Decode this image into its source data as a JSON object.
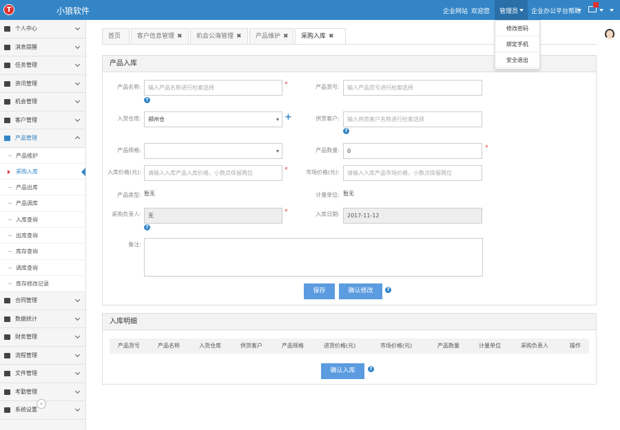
{
  "header": {
    "logo_letter": "T",
    "logo_text": "",
    "app_name": "小狼软件",
    "links": [
      "企业网站",
      "欢迎您"
    ],
    "user": "管理员",
    "help": "企业办公平台帮助"
  },
  "user_menu": [
    "修改密码",
    "绑定手机",
    "安全退出"
  ],
  "sidebar": {
    "items": [
      {
        "label": "个人中心",
        "icon": "user-icon"
      },
      {
        "label": "消息提醒",
        "icon": "bell-icon"
      },
      {
        "label": "任务管理",
        "icon": "edit-icon"
      },
      {
        "label": "资讯管理",
        "icon": "file-icon"
      },
      {
        "label": "机会管理",
        "icon": "list-icon"
      },
      {
        "label": "客户管理",
        "icon": "users-icon"
      },
      {
        "label": "产品管理",
        "icon": "dropbox-icon"
      }
    ],
    "product_sub": [
      "产品维护",
      "采购入库",
      "产品出库",
      "产品调库",
      "入库查询",
      "出库查询",
      "库存查询",
      "调库查询",
      "库存修改记录"
    ],
    "items_after": [
      {
        "label": "合同管理",
        "icon": "folder-open-icon"
      },
      {
        "label": "数据统计",
        "icon": "random-icon"
      },
      {
        "label": "财务管理",
        "icon": "yen-icon"
      },
      {
        "label": "流程管理",
        "icon": "retweet-icon"
      },
      {
        "label": "文件管理",
        "icon": "document-icon"
      },
      {
        "label": "考勤管理",
        "icon": "clock-icon"
      },
      {
        "label": "系统设置",
        "icon": "gear-icon"
      }
    ],
    "collapse": "«"
  },
  "tabs": [
    {
      "label": "首页",
      "closable": false
    },
    {
      "label": "客户信息管理",
      "closable": true
    },
    {
      "label": "机会公海管理",
      "closable": true
    },
    {
      "label": "产品维护",
      "closable": true
    },
    {
      "label": "采购入库",
      "closable": true
    }
  ],
  "form": {
    "title": "产品入库",
    "product_name": {
      "label": "产品名称:",
      "placeholder": "输入产品名称进行检索选择"
    },
    "product_code": {
      "label": "产品货号:",
      "placeholder": "输入产品货号进行检索选择"
    },
    "warehouse": {
      "label": "入货仓库:",
      "value": "郑州仓"
    },
    "supplier": {
      "label": "供货客户:",
      "placeholder": "输入供货客户名称进行检索选择"
    },
    "spec": {
      "label": "产品规格:",
      "value": ""
    },
    "quantity": {
      "label": "产品数量:",
      "value": "0"
    },
    "in_price": {
      "label": "入库价格(元):",
      "placeholder": "请输入入库产品入库价格，小数点保留两位"
    },
    "market_price": {
      "label": "市场价格(元):",
      "placeholder": "请输入入库产品市场价格，小数点保留两位"
    },
    "product_type": {
      "label": "产品类型:",
      "value": "暂无"
    },
    "unit": {
      "label": "计量单位:",
      "value": "暂无"
    },
    "buyer": {
      "label": "采购负责人:",
      "value": "无"
    },
    "date": {
      "label": "入库日期:",
      "value": "2017-11-12"
    },
    "remark": {
      "label": "备注:"
    },
    "save": "保存",
    "confirm": "确认修改",
    "required": "*",
    "help": "?",
    "plus": "+"
  },
  "detail": {
    "title": "入库明细",
    "columns": [
      "产品货号",
      "产品名称",
      "入货仓库",
      "供货客户",
      "产品规格",
      "进货价格(元)",
      "市场价格(元)",
      "产品数量",
      "计量单位",
      "采购负责人",
      "操作"
    ],
    "confirm": "确认入库"
  }
}
